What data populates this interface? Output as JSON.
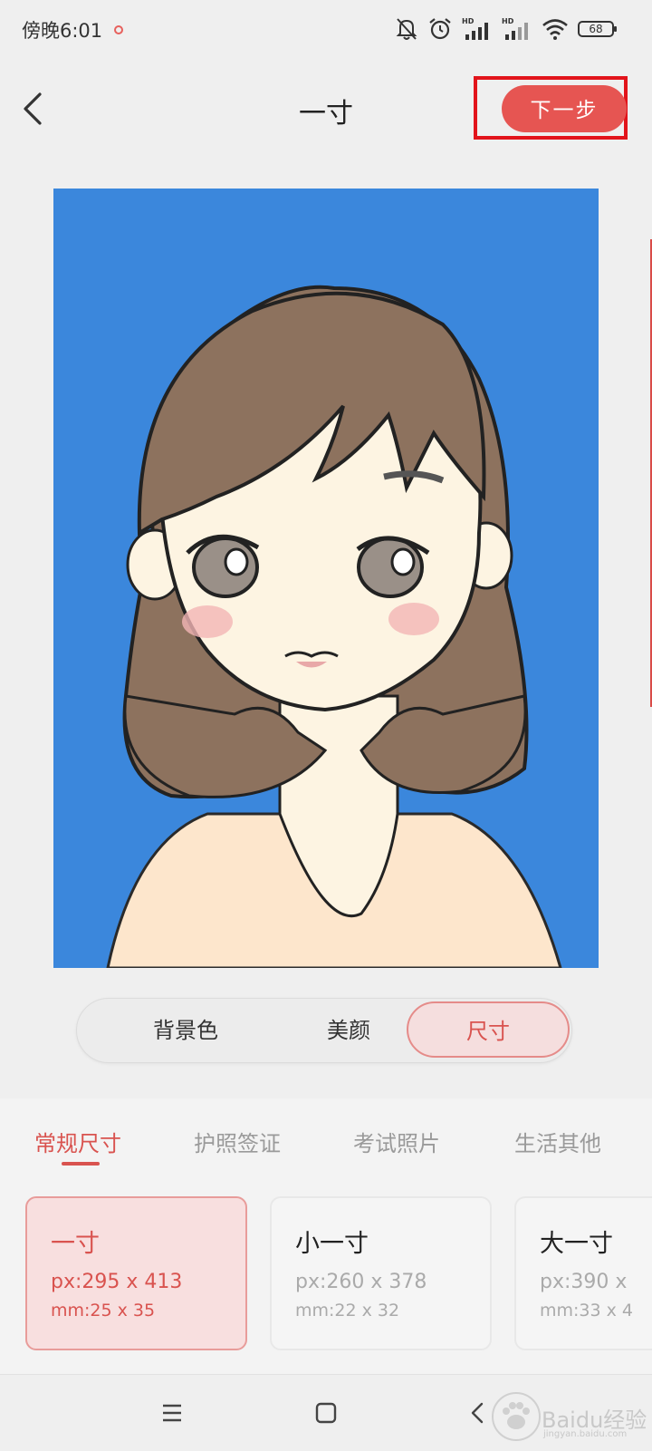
{
  "status_bar": {
    "time": "傍晚6:01",
    "battery": "68",
    "icons": [
      "bell-muted-icon",
      "alarm-icon",
      "hd-signal-icon",
      "hd-signal-icon",
      "wifi-icon",
      "battery-icon"
    ]
  },
  "header": {
    "title": "一寸",
    "next_label": "下一步",
    "back_icon": "chevron-left-icon"
  },
  "preview": {
    "background_color": "#3b87dc"
  },
  "mode_switch": {
    "options": [
      "背景色",
      "美颜",
      "尺寸"
    ],
    "selected": "尺寸"
  },
  "categories": {
    "tabs": [
      "常规尺寸",
      "护照签证",
      "考试照片",
      "生活其他"
    ],
    "active": "常规尺寸"
  },
  "sizes": [
    {
      "name": "一寸",
      "px": "px:295 x 413",
      "mm": "mm:25 x 35",
      "selected": true
    },
    {
      "name": "小一寸",
      "px": "px:260 x 378",
      "mm": "mm:22 x 32",
      "selected": false
    },
    {
      "name": "大一寸",
      "px": "px:390 x",
      "mm": "mm:33 x 4",
      "selected": false
    }
  ],
  "nav_bar": {
    "icons": [
      "menu-icon",
      "home-icon",
      "back-icon"
    ]
  },
  "watermark": {
    "text": "Baidu经验",
    "sub": "jingyan.baidu.com"
  },
  "colors": {
    "accent": "#e65552",
    "highlight_box": "#e2141b"
  }
}
